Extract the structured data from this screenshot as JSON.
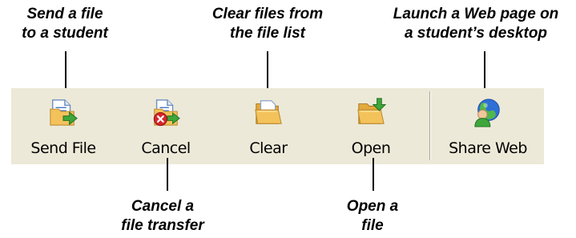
{
  "callouts": {
    "send_file": {
      "line1": "Send a file",
      "line2": "to a student"
    },
    "clear": {
      "line1": "Clear files from",
      "line2": "the file list"
    },
    "share_web": {
      "line1": "Launch a Web page on",
      "line2": "a student’s desktop"
    },
    "cancel": {
      "line1": "Cancel a",
      "line2": "file transfer"
    },
    "open": {
      "line1": "Open a",
      "line2": "file"
    }
  },
  "toolbar": {
    "buttons": [
      {
        "label": "Send File",
        "icon": "send-file-icon"
      },
      {
        "label": "Cancel",
        "icon": "cancel-transfer-icon"
      },
      {
        "label": "Clear",
        "icon": "clear-folder-icon"
      },
      {
        "label": "Open",
        "icon": "open-folder-icon"
      },
      {
        "label": "Share Web",
        "icon": "share-web-icon"
      }
    ]
  },
  "colors": {
    "toolbar_background": "#ece9d8",
    "separator": "#aca899",
    "folder": "#f3c25a",
    "arrow_green": "#3ea63a",
    "cancel_red": "#d8262b",
    "globe_blue": "#2f6fd6"
  }
}
